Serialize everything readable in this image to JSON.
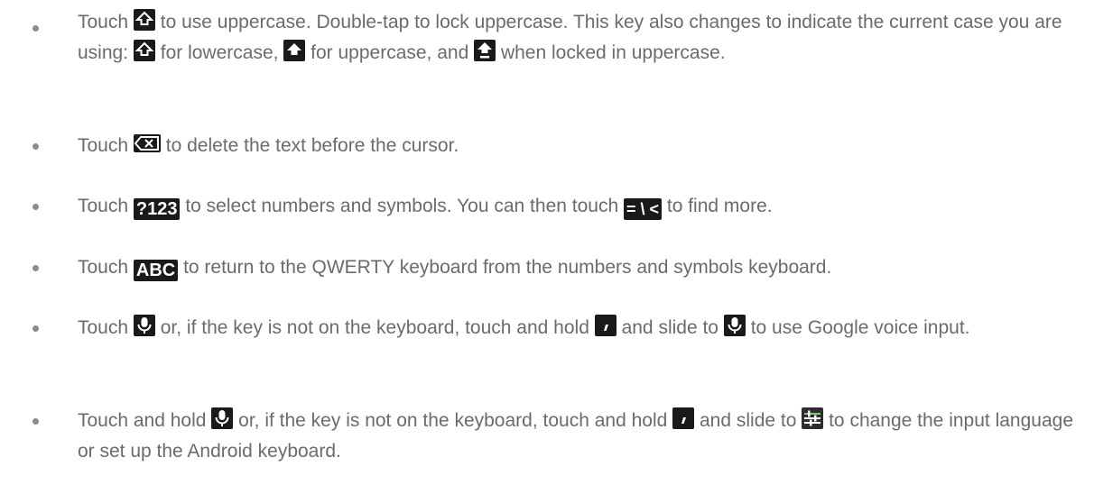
{
  "bullets": [
    {
      "seg": [
        "Touch",
        "to use uppercase. Double-tap to lock uppercase. This key also changes to indicate the current case you are using:",
        "for lowercase,",
        "for uppercase, and",
        "when locked in uppercase."
      ]
    },
    {
      "seg": [
        "Touch",
        "to delete the text before the cursor."
      ]
    },
    {
      "seg": [
        "Touch",
        "to select numbers and symbols. You can then touch",
        "to find more."
      ],
      "keys": {
        "numbers": "?123",
        "more": "= \\ <"
      }
    },
    {
      "seg": [
        "Touch",
        "to return to the QWERTY keyboard from the numbers and symbols keyboard."
      ],
      "keys": {
        "abc": "ABC"
      }
    },
    {
      "seg": [
        "Touch",
        "or, if the key is not on the keyboard, touch and hold",
        "and slide to",
        "to use Google voice input."
      ]
    },
    {
      "seg": [
        "Touch and hold",
        "or, if the key is not on the keyboard, touch and hold",
        "and slide to",
        "to change the input language or set up the Android keyboard."
      ]
    }
  ],
  "icons": {
    "shift": "shift-arrow-outline-icon",
    "shift_filled": "shift-arrow-filled-icon",
    "shift_locked": "shift-arrow-locked-icon",
    "backspace": "backspace-icon",
    "mic": "microphone-icon",
    "comma": "comma-key-icon",
    "settings": "settings-sliders-icon"
  },
  "colors": {
    "text": "#6b6b6b",
    "bullet": "#8c8c8c",
    "key_bg": "#1a1a1a",
    "key_fg": "#ffffff"
  }
}
